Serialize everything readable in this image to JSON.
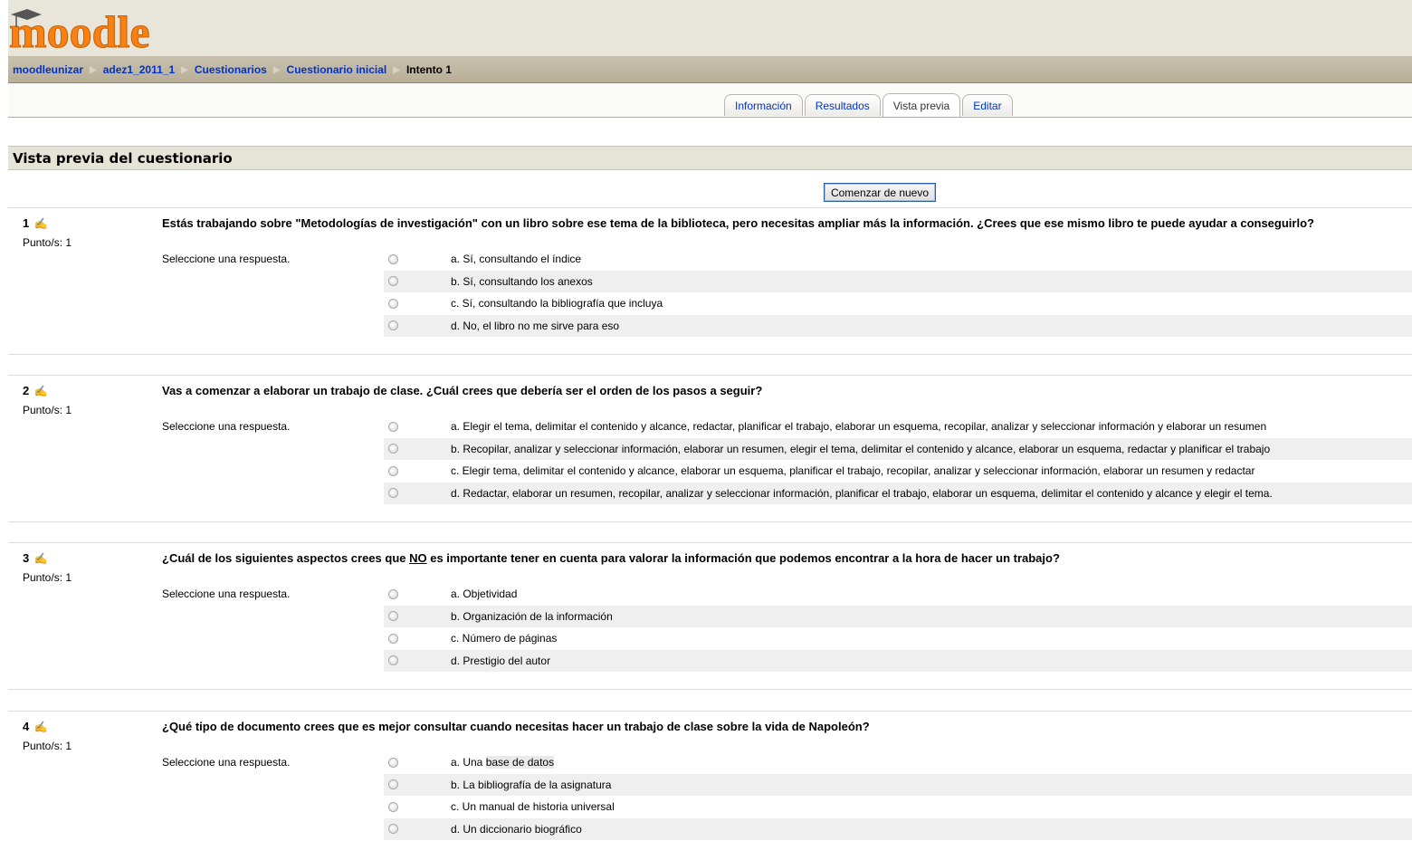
{
  "logo_text": "moodle",
  "breadcrumb": {
    "items": [
      "moodleunizar",
      "adez1_2011_1",
      "Cuestionarios",
      "Cuestionario inicial"
    ],
    "current": "Intento 1"
  },
  "tabs": [
    {
      "label": "Información"
    },
    {
      "label": "Resultados"
    },
    {
      "label": "Vista previa"
    },
    {
      "label": "Editar"
    }
  ],
  "heading": "Vista previa del cuestionario",
  "restart_button": "Comenzar de nuevo",
  "questions": [
    {
      "number": "1",
      "points": "Punto/s: 1",
      "text": "Estás trabajando sobre \"Metodologías de investigación\" con un libro sobre ese tema de la biblioteca, pero necesitas ampliar más la información. ¿Crees que ese mismo libro te puede ayudar a conseguirlo?",
      "prompt": "Seleccione una respuesta.",
      "answers": [
        "a. Sí, consultando el índice",
        "b. Sí, consultando los anexos",
        "c. Sí, consultando la bibliografía que incluya",
        "d. No, el libro no me sirve para eso"
      ]
    },
    {
      "number": "2",
      "points": "Punto/s: 1",
      "text": "Vas a comenzar a elaborar un trabajo de clase. ¿Cuál crees que debería ser el orden de los pasos a seguir?",
      "prompt": "Seleccione una respuesta.",
      "answers": [
        "a. Elegir el tema, delimitar el contenido y alcance, redactar, planificar el trabajo, elaborar un esquema, recopilar, analizar y seleccionar información y elaborar un resumen",
        "b. Recopilar, analizar y seleccionar información, elaborar un resumen, elegir el tema, delimitar el contenido y alcance, elaborar un esquema, redactar y planificar el trabajo",
        "c. Elegir tema, delimitar el contenido y alcance, elaborar un esquema, planificar el trabajo, recopilar, analizar y seleccionar información, elaborar un resumen y redactar",
        "d. Redactar, elaborar un resumen, recopilar, analizar y seleccionar información, planificar el trabajo, elaborar un esquema, delimitar el contenido y alcance y elegir el tema."
      ]
    },
    {
      "number": "3",
      "points": "Punto/s: 1",
      "text_before": "¿Cuál de los siguientes aspectos crees que ",
      "text_underlined": "NO",
      "text_after": " es importante tener en cuenta para valorar la información que podemos encontrar a la hora de hacer un trabajo?",
      "prompt": "Seleccione una respuesta.",
      "answers": [
        "a. Objetividad",
        "b. Organización de la información",
        "c. Número de páginas",
        "d. Prestigio del autor"
      ]
    },
    {
      "number": "4",
      "points": "Punto/s: 1",
      "text": "¿Qué tipo de documento crees que es mejor consultar cuando necesitas hacer un trabajo de clase sobre la vida de Napoleón?",
      "prompt": "Seleccione una respuesta.",
      "answer_a_prefix": "a. Una ",
      "answer_a_highlight": "base de datos",
      "answers": [
        "a. Una base de datos",
        "b. La bibliografía de la asignatura",
        "c. Un manual de historia universal",
        "d. Un diccionario biográfico"
      ]
    }
  ],
  "colors": {
    "link": "#0033cc",
    "header_bg": "#e8e5db",
    "navbar_bg": "#bfb6a1",
    "logo_orange": "#f98012"
  }
}
